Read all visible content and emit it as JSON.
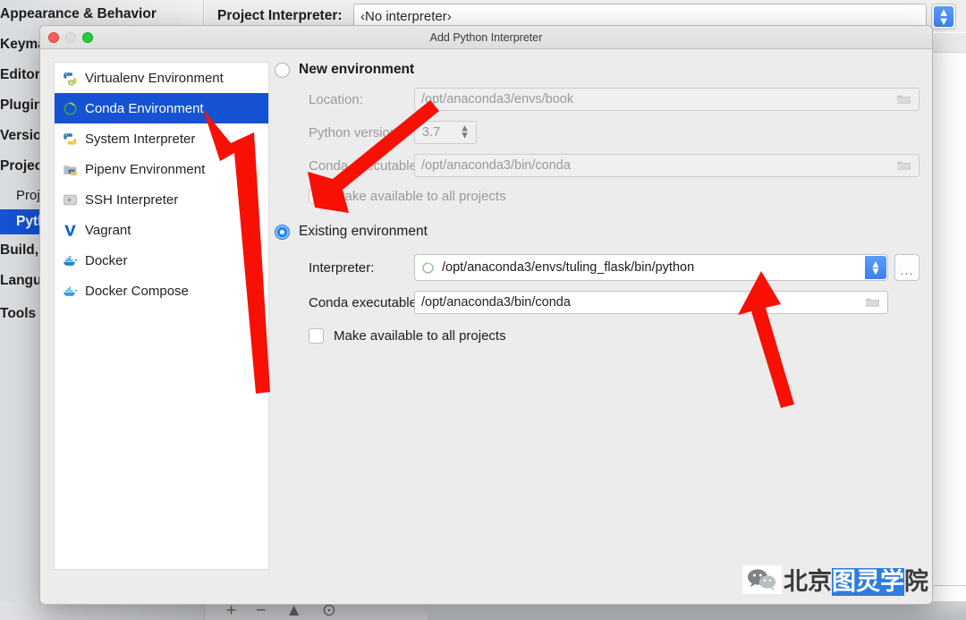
{
  "background_window": {
    "sidebar_items": [
      {
        "label": "Appearance & Behavior",
        "style": "bold"
      },
      {
        "label": "Keymap",
        "style": "bold"
      },
      {
        "label": "Editor",
        "style": "bold"
      },
      {
        "label": "Plugins",
        "style": "bold"
      },
      {
        "label": "Version",
        "style": "bold"
      },
      {
        "label": "Project",
        "style": "bold"
      },
      {
        "label": "Proje",
        "style": "indent"
      },
      {
        "label": "Python",
        "style": "selected"
      },
      {
        "label": "Build, E",
        "style": "bold"
      },
      {
        "label": "Langua",
        "style": "bold"
      },
      {
        "label": "Tools",
        "style": "bold"
      }
    ],
    "project_interpreter_label": "Project Interpreter:",
    "project_interpreter_value": "‹No interpreter›",
    "bottom_toolbar_icons": [
      "+",
      "−",
      "▲",
      "⊙"
    ]
  },
  "dialog": {
    "title": "Add Python Interpreter",
    "traffic_lights": [
      "close-red",
      "minimize-gray",
      "maximize-green"
    ],
    "env_list": [
      {
        "label": "Virtualenv Environment",
        "icon": "python-virtualenv-icon",
        "selected": false
      },
      {
        "label": "Conda Environment",
        "icon": "conda-circle-icon",
        "selected": true
      },
      {
        "label": "System Interpreter",
        "icon": "python-icon",
        "selected": false
      },
      {
        "label": "Pipenv Environment",
        "icon": "pipenv-folder-icon",
        "selected": false
      },
      {
        "label": "SSH Interpreter",
        "icon": "ssh-terminal-icon",
        "selected": false
      },
      {
        "label": "Vagrant",
        "icon": "vagrant-v-icon",
        "selected": false
      },
      {
        "label": "Docker",
        "icon": "docker-whale-icon",
        "selected": false
      },
      {
        "label": "Docker Compose",
        "icon": "docker-compose-icon",
        "selected": false
      }
    ],
    "new_environment": {
      "radio_label": "New environment",
      "selected": false,
      "location_label": "Location:",
      "location_value": "/opt/anaconda3/envs/book",
      "python_version_label": "Python version:",
      "python_version_value": "3.7",
      "conda_executable_label": "Conda executable:",
      "conda_executable_value": "/opt/anaconda3/bin/conda",
      "make_available_label": "Make available to all projects",
      "make_available_checked": false
    },
    "existing_environment": {
      "radio_label": "Existing environment",
      "selected": true,
      "interpreter_label": "Interpreter:",
      "interpreter_value": "/opt/anaconda3/envs/tuling_flask/bin/python",
      "interpreter_browse_label": "...",
      "conda_executable_label": "Conda executable:",
      "conda_executable_value": "/opt/anaconda3/bin/conda",
      "make_available_label": "Make available to all projects",
      "make_available_checked": false
    }
  },
  "annotations": {
    "arrows": [
      {
        "name": "arrow-to-conda-environment",
        "color": "#f81005"
      },
      {
        "name": "arrow-to-make-available-checkbox",
        "color": "#f81005"
      },
      {
        "name": "arrow-to-interpreter-path",
        "color": "#f81005"
      }
    ]
  },
  "watermark": {
    "icon": "wechat-icon",
    "text_prefix": "北京",
    "text_highlight": "图灵学",
    "text_suffix": "院"
  },
  "colors": {
    "selection_blue": "#1552d4",
    "accent_blue": "#3d7ff0",
    "arrow_red": "#f81005",
    "dialog_bg": "#ececec",
    "list_bg": "#ffffff"
  }
}
